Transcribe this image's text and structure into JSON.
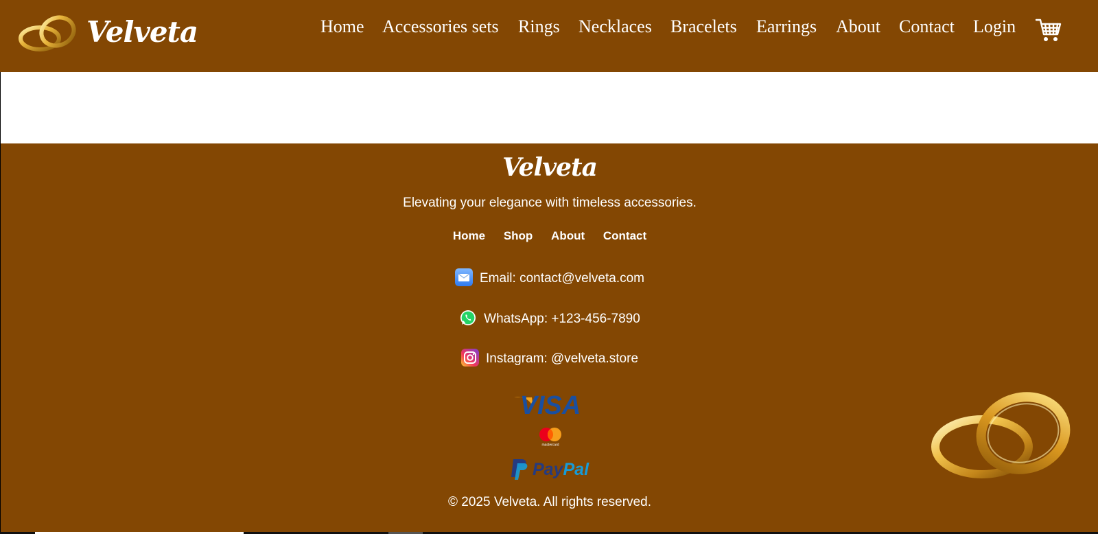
{
  "header": {
    "brand": "Velveta",
    "nav": [
      "Home",
      "Accessories sets",
      "Rings",
      "Necklaces",
      "Bracelets",
      "Earrings",
      "About",
      "Contact",
      "Login"
    ],
    "cart_icon": "shopping-cart-icon"
  },
  "footer": {
    "brand": "Velveta",
    "tagline": "Elevating your elegance with timeless accessories.",
    "links": [
      "Home",
      "Shop",
      "About",
      "Contact"
    ],
    "contacts": {
      "email": "Email: contact@velveta.com",
      "whatsapp": "WhatsApp: +123-456-7890",
      "instagram": "Instagram: @velveta.store"
    },
    "payments": {
      "visa": "VISA",
      "mastercard": "mastercard",
      "paypal_pay": "Pay",
      "paypal_pal": "Pal"
    },
    "copyright": "© 2025 Velveta. All rights reserved."
  },
  "colors": {
    "brand_brown": "#834703",
    "white": "#ffffff",
    "visa_blue": "#1a4fa0",
    "paypal_dark": "#253b80",
    "paypal_light": "#179bd7"
  }
}
